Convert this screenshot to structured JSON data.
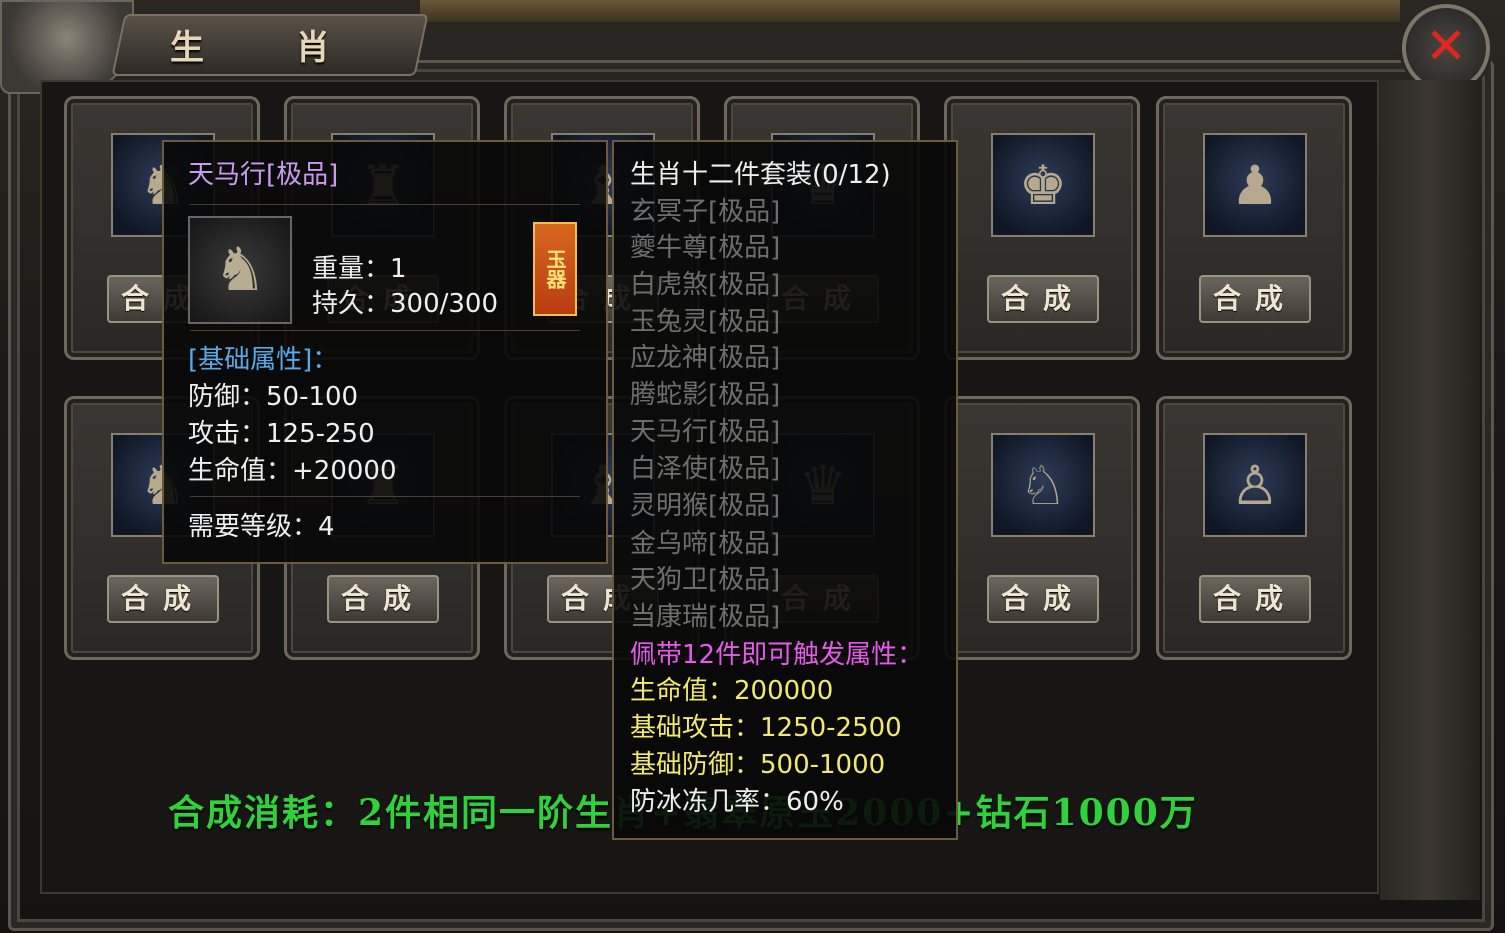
{
  "window": {
    "title": "生  肖",
    "close_glyph": "✕"
  },
  "slots": [
    {
      "button": "合成",
      "icon": "zodiac-figure-icon"
    },
    {
      "button": "合成",
      "icon": "zodiac-figure-icon"
    },
    {
      "button": "合成",
      "icon": "zodiac-figure-icon"
    },
    {
      "button": "合成",
      "icon": "zodiac-figure-icon"
    },
    {
      "button": "合成",
      "icon": "dragon-figure-icon"
    },
    {
      "button": "合成",
      "icon": "snake-figure-icon"
    },
    {
      "button": "合成",
      "icon": "horse-figure-icon"
    },
    {
      "button": "合成",
      "icon": "zodiac-figure-icon"
    },
    {
      "button": "合成",
      "icon": "zodiac-figure-icon"
    },
    {
      "button": "合成",
      "icon": "rooster-figure-icon"
    },
    {
      "button": "合成",
      "icon": "dog-figure-icon"
    },
    {
      "button": "合成",
      "icon": "pig-figure-icon"
    }
  ],
  "item_tooltip": {
    "name": "天马行[极品]",
    "weight": "重量：1",
    "durability": "持久：300/300",
    "badge": "玉器",
    "base_header": "[基础属性]：",
    "defense": "防御：50-100",
    "attack": "攻击：125-250",
    "hp": "生命值：+20000",
    "level_req": "需要等级：4"
  },
  "set_tooltip": {
    "title": "生肖十二件套装(0/12)",
    "pieces": [
      "玄冥子[极品]",
      "夔牛尊[极品]",
      "白虎煞[极品]",
      "玉兔灵[极品]",
      "应龙神[极品]",
      "腾蛇影[极品]",
      "天马行[极品]",
      "白泽使[极品]",
      "灵明猴[极品]",
      "金乌啼[极品]",
      "天狗卫[极品]",
      "当康瑞[极品]"
    ],
    "trigger": "佩带12件即可触发属性：",
    "hp": "生命值：200000",
    "attack": "基础攻击：1250-2500",
    "defense": "基础防御：500-1000",
    "freeze_resist": "防冰冻几率：60%"
  },
  "cost_text": "合成消耗：2件相同一阶生肖+翡翠原玉2000+钻石1000万"
}
